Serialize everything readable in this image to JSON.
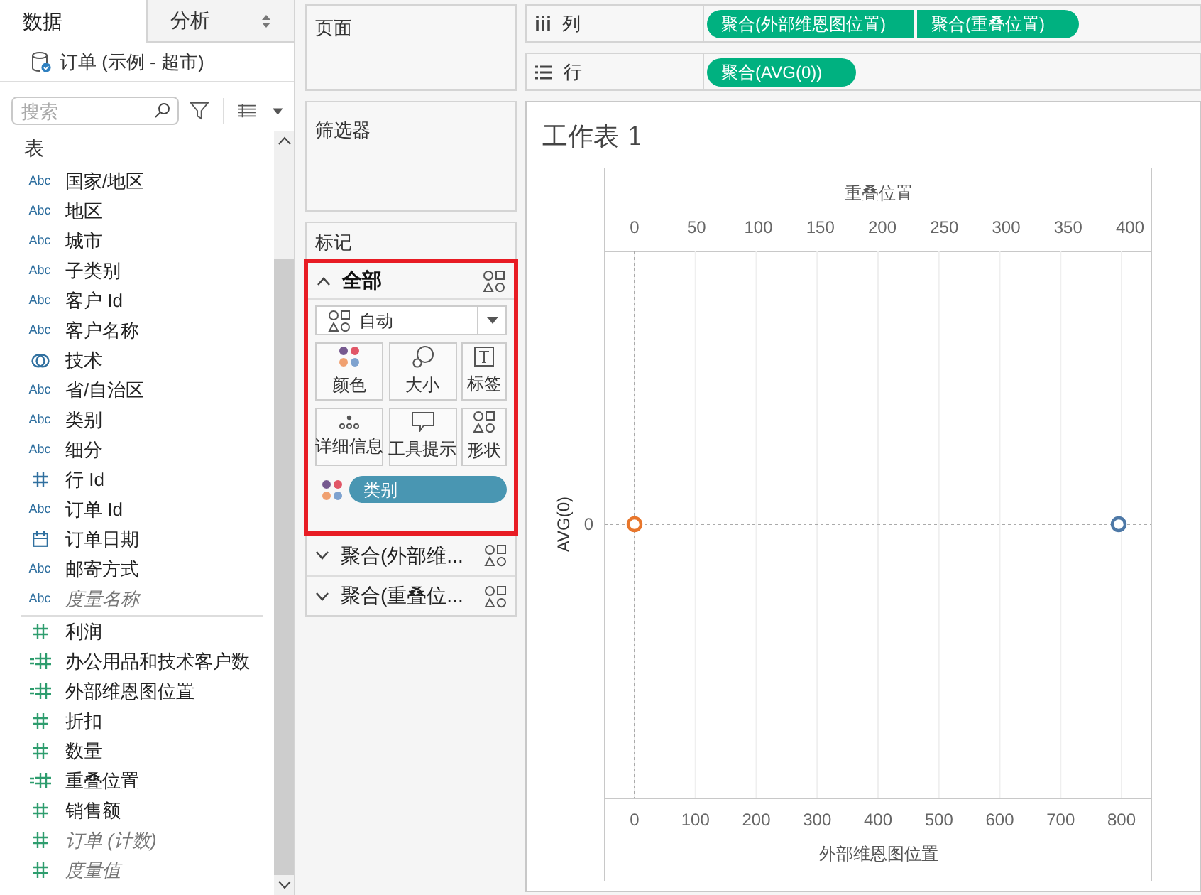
{
  "data_pane": {
    "tabs": [
      {
        "label": "数据",
        "selected": true
      },
      {
        "label": "分析",
        "selected": false
      }
    ],
    "datasource": "订单 (示例 - 超市)",
    "search": {
      "placeholder": "搜索"
    },
    "section_title": "表",
    "fields": [
      {
        "name": "国家/地区",
        "kind": "abc",
        "type_label": "Abc",
        "italic": false
      },
      {
        "name": "地区",
        "kind": "abc",
        "type_label": "Abc",
        "italic": false
      },
      {
        "name": "城市",
        "kind": "abc",
        "type_label": "Abc",
        "italic": false
      },
      {
        "name": "子类别",
        "kind": "abc",
        "type_label": "Abc",
        "italic": false
      },
      {
        "name": "客户 Id",
        "kind": "abc",
        "type_label": "Abc",
        "italic": false
      },
      {
        "name": "客户名称",
        "kind": "abc",
        "type_label": "Abc",
        "italic": false
      },
      {
        "name": "技术",
        "kind": "set",
        "italic": false
      },
      {
        "name": "省/自治区",
        "kind": "abc",
        "type_label": "Abc",
        "italic": false
      },
      {
        "name": "类别",
        "kind": "abc",
        "type_label": "Abc",
        "italic": false
      },
      {
        "name": "细分",
        "kind": "abc",
        "type_label": "Abc",
        "italic": false
      },
      {
        "name": "行 Id",
        "kind": "dimnum",
        "italic": false
      },
      {
        "name": "订单 Id",
        "kind": "abc",
        "type_label": "Abc",
        "italic": false
      },
      {
        "name": "订单日期",
        "kind": "date",
        "italic": false
      },
      {
        "name": "邮寄方式",
        "kind": "abc",
        "type_label": "Abc",
        "italic": false
      },
      {
        "name": "度量名称",
        "kind": "abc",
        "type_label": "Abc",
        "italic": true
      },
      {
        "name": "利润",
        "kind": "num",
        "italic": false
      },
      {
        "name": "办公用品和技术客户数",
        "kind": "calc",
        "italic": false
      },
      {
        "name": "外部维恩图位置",
        "kind": "calc",
        "italic": false
      },
      {
        "name": "折扣",
        "kind": "num",
        "italic": false
      },
      {
        "name": "数量",
        "kind": "num",
        "italic": false
      },
      {
        "name": "重叠位置",
        "kind": "calc",
        "italic": false
      },
      {
        "name": "销售额",
        "kind": "num",
        "italic": false
      },
      {
        "name": "订单 (计数)",
        "kind": "num",
        "italic": true
      },
      {
        "name": "度量值",
        "kind": "num",
        "italic": true
      }
    ]
  },
  "pages_card": {
    "title": "页面"
  },
  "filters_card": {
    "title": "筛选器"
  },
  "marks_card": {
    "title": "标记",
    "all": {
      "label": "全部",
      "expanded": true,
      "mark_type": "自动",
      "buttons": [
        {
          "label": "颜色",
          "kind": "color"
        },
        {
          "label": "大小",
          "kind": "size"
        },
        {
          "label": "标签",
          "kind": "label"
        },
        {
          "label": "详细信息",
          "kind": "detail"
        },
        {
          "label": "工具提示",
          "kind": "tooltip"
        },
        {
          "label": "形状",
          "kind": "shape"
        }
      ],
      "color_pill": "类别"
    },
    "layers": [
      {
        "label": "聚合(外部维...",
        "expanded": false
      },
      {
        "label": "聚合(重叠位...",
        "expanded": false
      }
    ]
  },
  "columns_shelf": {
    "label": "列",
    "pills": [
      "聚合(外部维恩图位置)",
      "聚合(重叠位置)"
    ]
  },
  "rows_shelf": {
    "label": "行",
    "pills": [
      "聚合(AVG(0))"
    ]
  },
  "sheet": {
    "title": "工作表 1",
    "top_axis": {
      "label": "重叠位置",
      "ticks": [
        "0",
        "50",
        "100",
        "150",
        "200",
        "250",
        "300",
        "350",
        "400"
      ]
    },
    "y_axis": {
      "label": "AVG(0)",
      "ticks": [
        "0"
      ]
    },
    "bottom_axis": {
      "label": "外部维恩图位置",
      "ticks": [
        "0",
        "100",
        "200",
        "300",
        "400",
        "500",
        "600",
        "700",
        "800"
      ]
    },
    "marks": [
      {
        "color": "#e8762b"
      },
      {
        "color": "#4e79a7"
      }
    ]
  }
}
